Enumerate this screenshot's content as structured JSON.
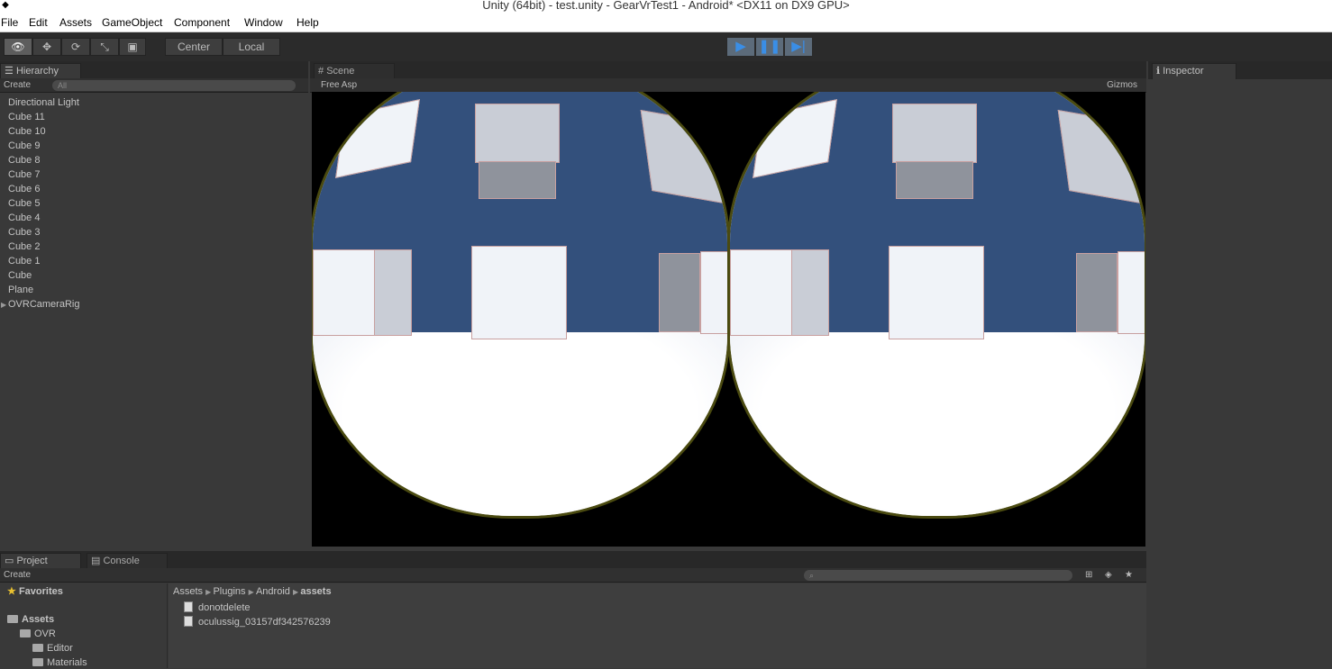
{
  "window": {
    "title": "Unity (64bit) - test.unity - GearVrTest1 - Android* <DX11 on DX9 GPU>"
  },
  "menu": [
    "File",
    "Edit",
    "Assets",
    "GameObject",
    "Component",
    "Window",
    "Help"
  ],
  "toolbar": {
    "pivot": "Center",
    "space": "Local",
    "play_icon": "play-icon",
    "pause_icon": "pause-icon",
    "step_icon": "step-icon"
  },
  "hierarchy": {
    "tab": "Hierarchy",
    "create": "Create",
    "search_placeholder": "All",
    "items": [
      "Directional Light",
      "Cube 11",
      "Cube 10",
      "Cube 9",
      "Cube 8",
      "Cube 7",
      "Cube 6",
      "Cube 5",
      "Cube 4",
      "Cube 3",
      "Cube 2",
      "Cube 1",
      "Cube",
      "Plane",
      "OVRCameraRig"
    ]
  },
  "scene": {
    "tab": "Scene",
    "aspect": "Free Asp",
    "gizmos": "Gizmos"
  },
  "inspector": {
    "tab": "Inspector"
  },
  "project": {
    "tab": "Project",
    "console_tab": "Console",
    "create": "Create",
    "favorites": "Favorites",
    "assets": "Assets",
    "tree": [
      "OVR",
      "Editor",
      "Materials"
    ],
    "breadcrumb": [
      "Assets",
      "Plugins",
      "Android",
      "assets"
    ],
    "files": [
      "donotdelete",
      "oculussig_03157df342576239"
    ]
  },
  "colors": {
    "sky": "#33507c",
    "ground": "#ffffff",
    "play": "#3a8ee6"
  }
}
